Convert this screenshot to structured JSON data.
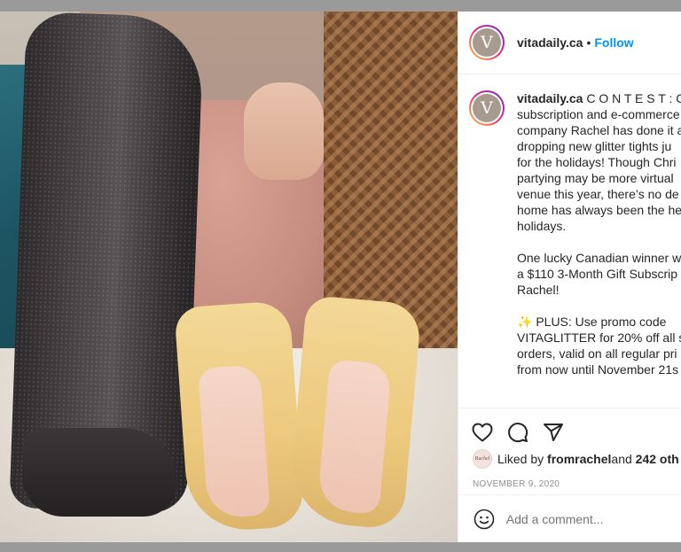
{
  "post": {
    "username": "vitadaily.ca",
    "separator": "•",
    "follow_label": "Follow",
    "avatar_letter": "V"
  },
  "caption": {
    "username": "vitadaily.ca",
    "lines": [
      " C O N T E S T : C",
      "subscription and e-commerce",
      "company Rachel has done it a",
      "dropping new glitter tights ju",
      "for the holidays! Though Chri",
      "partying may be more virtual",
      "venue this year, there’s no de",
      "home has always been the he",
      "holidays.",
      "",
      "One lucky Canadian winner w",
      "a $110 3-Month Gift Subscrip",
      "Rachel!",
      "",
      "✨ PLUS: Use promo code",
      "VITAGLITTER for 20% off all s",
      "orders, valid on all regular pri",
      "from now until November 21s"
    ]
  },
  "likes": {
    "prefix": "Liked by ",
    "user": "fromrachel",
    "middle": " and ",
    "count": "242 oth",
    "avatar_text": "Rachel"
  },
  "date": "NOVEMBER 9, 2020",
  "comment": {
    "placeholder": "Add a comment..."
  }
}
